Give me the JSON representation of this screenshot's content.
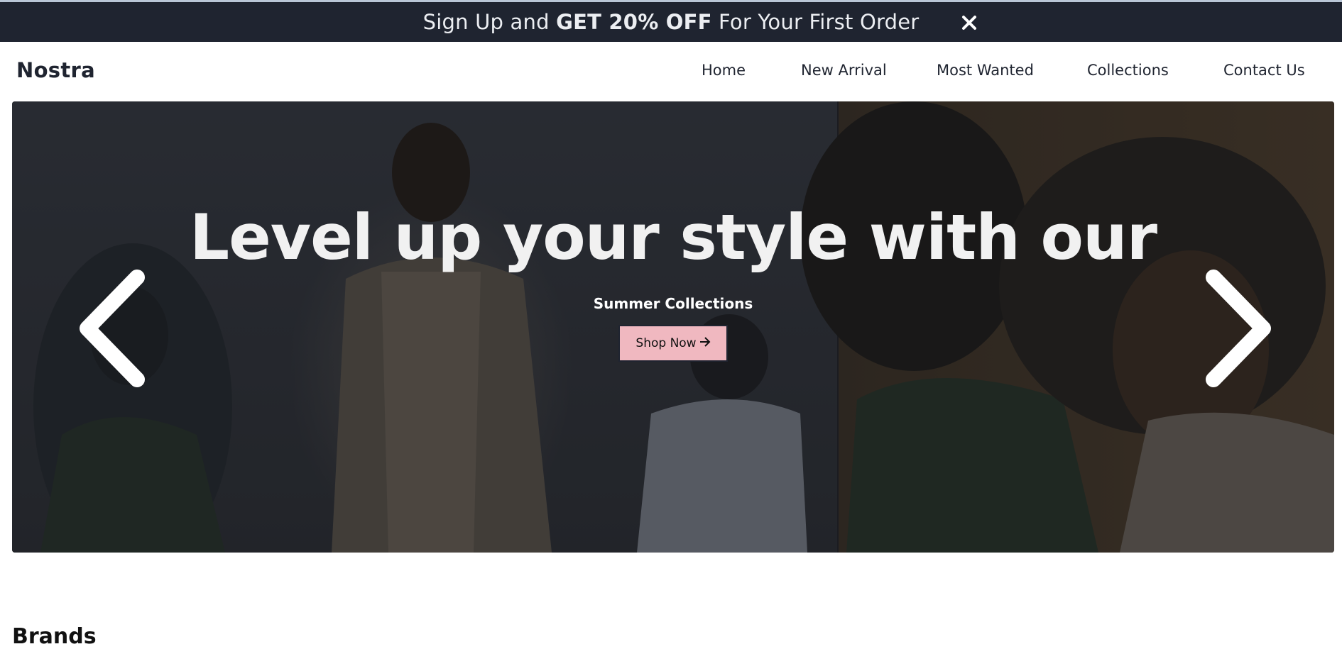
{
  "promo": {
    "text_before": "Sign Up and ",
    "text_bold": "GET 20% OFF",
    "text_after": " For Your First Order",
    "close_icon": "close-icon"
  },
  "nav": {
    "brand": "Nostra",
    "links": [
      "Home",
      "New Arrival",
      "Most Wanted",
      "Collections",
      "Contact Us"
    ]
  },
  "hero": {
    "title": "Level up your style with our",
    "subtitle": "Summer Collections",
    "button_label": "Shop Now",
    "button_icon": "arrow-right-icon",
    "prev_icon": "chevron-left-icon",
    "next_icon": "chevron-right-icon"
  },
  "brands": {
    "title": "Brands"
  },
  "colors": {
    "banner_bg": "#1f2430",
    "button_bg": "#f0b8c0",
    "text_dark": "#1f2430"
  }
}
